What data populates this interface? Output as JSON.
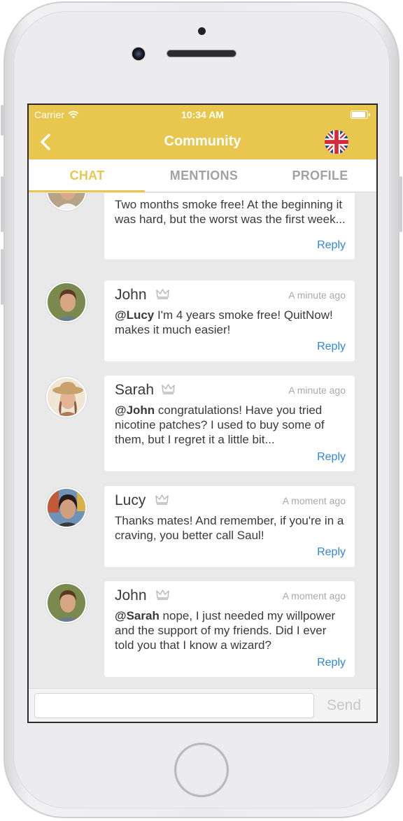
{
  "status_bar": {
    "carrier": "Carrier",
    "time": "10:34 AM"
  },
  "nav": {
    "title": "Community",
    "back_icon": "chevron-left-icon",
    "language_icon": "uk-flag-icon"
  },
  "tabs": [
    {
      "label": "CHAT",
      "active": true
    },
    {
      "label": "MENTIONS",
      "active": false
    },
    {
      "label": "PROFILE",
      "active": false
    }
  ],
  "messages": [
    {
      "author": "",
      "time": "",
      "mention": "",
      "text": "Two months smoke free! At the beginning it was hard, but the worst was the first week...",
      "reply_label": "Reply"
    },
    {
      "author": "John",
      "time": "A minute ago",
      "mention": "@Lucy",
      "text": " I'm 4 years smoke free! QuitNow! makes it much easier!",
      "reply_label": "Reply"
    },
    {
      "author": "Sarah",
      "time": "A minute ago",
      "mention": "@John",
      "text": " congratulations! Have you tried nicotine patches? I used to buy some of them, but I regret it a little bit...",
      "reply_label": "Reply"
    },
    {
      "author": "Lucy",
      "time": "A moment ago",
      "mention": "",
      "text": "Thanks mates! And remember, if you're in a craving, you better call Saul!",
      "reply_label": "Reply"
    },
    {
      "author": "John",
      "time": "A moment ago",
      "mention": "@Sarah",
      "text": " nope, I just needed my willpower and the support of my friends. Did I ever told you that I know a wizard?",
      "reply_label": "Reply"
    }
  ],
  "composer": {
    "placeholder": "",
    "send_label": "Send"
  },
  "colors": {
    "accent": "#e9c64d",
    "link": "#2f87d8",
    "background": "#e9e9e9"
  }
}
